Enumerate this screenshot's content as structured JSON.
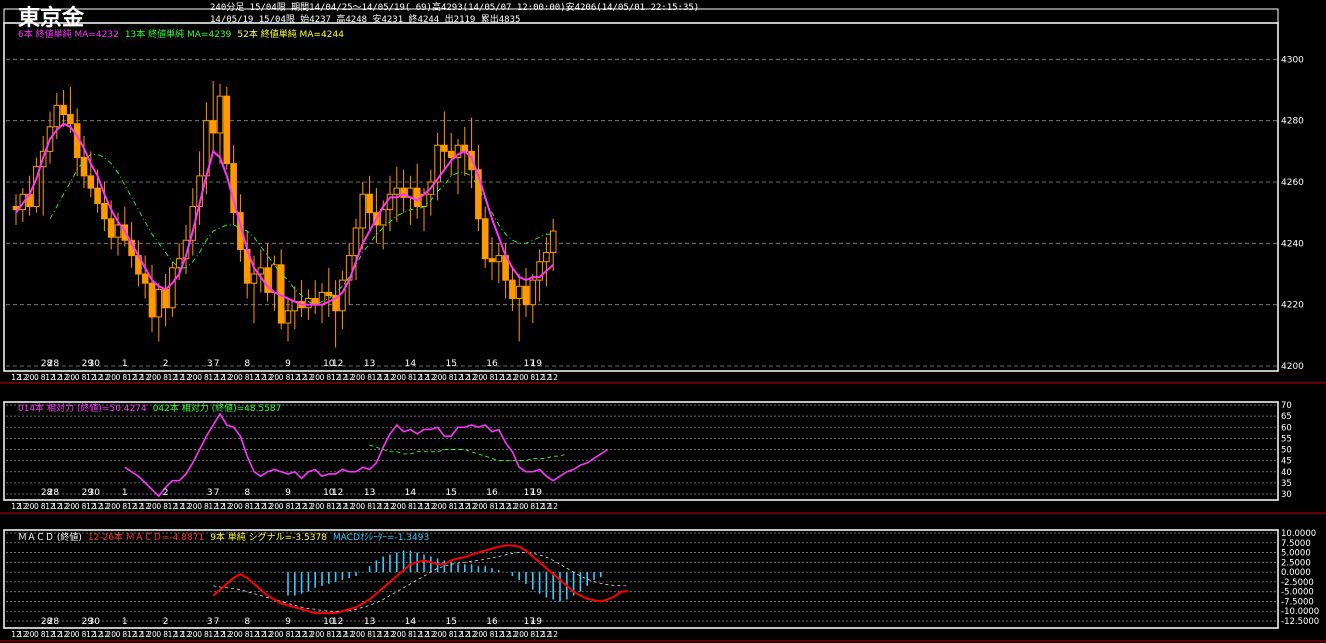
{
  "header": {
    "symbol": "東京金",
    "line1": "240分足 15/04限 期間14/04/25～14/05/19( 69)高4293(14/05/07 12:00:00)安4206(14/05/01 22:15:35)",
    "line2": "14/05/19 15/04限 始4237 高4248 安4231 終4244 出2119 累出4835"
  },
  "main_legend": [
    {
      "text": "6本 終値単純 MA=4232",
      "color": "#ff33ff"
    },
    {
      "text": "13本 終値単純 MA=4239",
      "color": "#33ff33"
    },
    {
      "text": "52本 終値単純 MA=4244",
      "color": "#ffff33"
    }
  ],
  "rsi_legend": [
    {
      "text": "014本 相対力 (終値)=50.4274",
      "color": "#ff33ff"
    },
    {
      "text": "042本 相対力 (終値)=48.5587",
      "color": "#33ff33"
    }
  ],
  "macd_legend": [
    {
      "text": "ＭＡＣＤ (終値)",
      "color": "#ffffff"
    },
    {
      "text": "12-26本 ＭＡＣＤ=-4.8871",
      "color": "#ff3333"
    },
    {
      "text": "9本 単純 シグナル=-3.5378",
      "color": "#ffff33"
    },
    {
      "text": "MACDｵｼﾚｰﾀｰ=-1.3493",
      "color": "#33ccff"
    }
  ],
  "colors": {
    "candle": "#ff9900",
    "ma6": "#ff33ff",
    "ma13": "#33ff33",
    "grid": "#888888",
    "border": "#ffffff",
    "separator": "#cc0000",
    "macd": "#ff0000",
    "signal": "#ffffff",
    "osc": "#33ccff"
  },
  "chart_data": [
    {
      "type": "candlestick",
      "id": "price",
      "ylim": [
        4200,
        4305
      ],
      "y_ticks": [
        "4200",
        "4220",
        "4240",
        "4260",
        "4280",
        "4300"
      ],
      "date_labels": [
        {
          "i": 4.5,
          "t": "28"
        },
        {
          "i": 5.5,
          "t": "28"
        },
        {
          "i": 10.5,
          "t": "29"
        },
        {
          "i": 11.5,
          "t": "30"
        },
        {
          "i": 16,
          "t": "1"
        },
        {
          "i": 22,
          "t": "2"
        },
        {
          "i": 28.5,
          "t": "3"
        },
        {
          "i": 29.5,
          "t": "7"
        },
        {
          "i": 34,
          "t": "8"
        },
        {
          "i": 40,
          "t": "9"
        },
        {
          "i": 46,
          "t": "10"
        },
        {
          "i": 47.3,
          "t": "12"
        },
        {
          "i": 52,
          "t": "13"
        },
        {
          "i": 58,
          "t": "14"
        },
        {
          "i": 64,
          "t": "15"
        },
        {
          "i": 70,
          "t": "16"
        },
        {
          "i": 75.5,
          "t": "17"
        },
        {
          "i": 76.5,
          "t": "19"
        }
      ],
      "time_cycle": [
        "12",
        "12",
        "20",
        "0",
        "8",
        "12"
      ],
      "ohlc": [
        [
          4252,
          4256,
          4246,
          4251
        ],
        [
          4251,
          4258,
          4247,
          4256
        ],
        [
          4256,
          4262,
          4249,
          4252
        ],
        [
          4252,
          4268,
          4250,
          4265
        ],
        [
          4265,
          4275,
          4249,
          4270
        ],
        [
          4270,
          4283,
          4266,
          4278
        ],
        [
          4278,
          4289,
          4274,
          4285
        ],
        [
          4285,
          4290,
          4278,
          4282
        ],
        [
          4282,
          4291,
          4276,
          4279
        ],
        [
          4279,
          4284,
          4262,
          4268
        ],
        [
          4268,
          4275,
          4258,
          4262
        ],
        [
          4262,
          4270,
          4255,
          4258
        ],
        [
          4258,
          4264,
          4250,
          4253
        ],
        [
          4253,
          4260,
          4244,
          4248
        ],
        [
          4248,
          4254,
          4238,
          4242
        ],
        [
          4242,
          4250,
          4236,
          4246
        ],
        [
          4246,
          4252,
          4239,
          4241
        ],
        [
          4241,
          4247,
          4232,
          4236
        ],
        [
          4236,
          4241,
          4226,
          4230
        ],
        [
          4230,
          4236,
          4222,
          4227
        ],
        [
          4227,
          4233,
          4211,
          4216
        ],
        [
          4216,
          4227,
          4208,
          4225
        ],
        [
          4225,
          4230,
          4213,
          4219
        ],
        [
          4219,
          4234,
          4216,
          4232
        ],
        [
          4232,
          4240,
          4228,
          4235
        ],
        [
          4235,
          4246,
          4230,
          4241
        ],
        [
          4241,
          4258,
          4236,
          4252
        ],
        [
          4252,
          4270,
          4246,
          4262
        ],
        [
          4262,
          4286,
          4256,
          4280
        ],
        [
          4280,
          4293,
          4270,
          4276
        ],
        [
          4276,
          4292,
          4266,
          4288
        ],
        [
          4288,
          4291,
          4264,
          4266
        ],
        [
          4266,
          4272,
          4246,
          4250
        ],
        [
          4250,
          4256,
          4234,
          4238
        ],
        [
          4238,
          4244,
          4222,
          4227
        ],
        [
          4227,
          4236,
          4214,
          4230
        ],
        [
          4230,
          4238,
          4224,
          4232
        ],
        [
          4232,
          4240,
          4221,
          4224
        ],
        [
          4224,
          4236,
          4218,
          4233
        ],
        [
          4233,
          4238,
          4212,
          4214
        ],
        [
          4214,
          4222,
          4208,
          4218
        ],
        [
          4218,
          4226,
          4212,
          4221
        ],
        [
          4221,
          4228,
          4216,
          4219
        ],
        [
          4219,
          4225,
          4215,
          4222
        ],
        [
          4222,
          4228,
          4217,
          4220
        ],
        [
          4220,
          4227,
          4214,
          4224
        ],
        [
          4224,
          4232,
          4216,
          4223
        ],
        [
          4223,
          4228,
          4206,
          4218
        ],
        [
          4218,
          4231,
          4212,
          4228
        ],
        [
          4228,
          4240,
          4220,
          4236
        ],
        [
          4236,
          4248,
          4228,
          4245
        ],
        [
          4245,
          4260,
          4238,
          4256
        ],
        [
          4256,
          4262,
          4244,
          4250
        ],
        [
          4250,
          4258,
          4240,
          4246
        ],
        [
          4246,
          4254,
          4238,
          4251
        ],
        [
          4251,
          4262,
          4244,
          4256
        ],
        [
          4256,
          4265,
          4247,
          4258
        ],
        [
          4258,
          4264,
          4250,
          4255
        ],
        [
          4255,
          4262,
          4246,
          4258
        ],
        [
          4258,
          4266,
          4248,
          4252
        ],
        [
          4252,
          4258,
          4244,
          4256
        ],
        [
          4256,
          4264,
          4249,
          4260
        ],
        [
          4260,
          4276,
          4254,
          4272
        ],
        [
          4272,
          4283,
          4264,
          4270
        ],
        [
          4270,
          4276,
          4262,
          4268
        ],
        [
          4268,
          4274,
          4256,
          4272
        ],
        [
          4272,
          4278,
          4262,
          4270
        ],
        [
          4270,
          4281,
          4258,
          4264
        ],
        [
          4264,
          4272,
          4244,
          4248
        ],
        [
          4248,
          4252,
          4232,
          4235
        ],
        [
          4235,
          4242,
          4228,
          4234
        ],
        [
          4234,
          4240,
          4227,
          4236
        ],
        [
          4236,
          4240,
          4222,
          4228
        ],
        [
          4228,
          4232,
          4218,
          4222
        ],
        [
          4222,
          4230,
          4208,
          4226
        ],
        [
          4226,
          4232,
          4216,
          4220
        ],
        [
          4220,
          4230,
          4214,
          4228
        ],
        [
          4228,
          4238,
          4221,
          4234
        ],
        [
          4234,
          4242,
          4226,
          4237
        ],
        [
          4237,
          4248,
          4231,
          4244
        ]
      ],
      "ma6": [
        4250,
        4253,
        4256,
        4261,
        4268,
        4274,
        4277,
        4279,
        4278,
        4275,
        4271,
        4266,
        4262,
        4256,
        4251,
        4247,
        4244,
        4240,
        4236,
        4232,
        4228,
        4226,
        4225,
        4227,
        4230,
        4236,
        4244,
        4253,
        4262,
        4270,
        4268,
        4262,
        4254,
        4246,
        4238,
        4232,
        4229,
        4226,
        4224,
        4223,
        4222,
        4221,
        4220,
        4220,
        4220,
        4220,
        4221,
        4222,
        4224,
        4228,
        4234,
        4240,
        4244,
        4248,
        4252,
        4255,
        4255,
        4256,
        4255,
        4254,
        4256,
        4258,
        4261,
        4264,
        4267,
        4269,
        4270,
        4268,
        4262,
        4255,
        4248,
        4242,
        4236,
        4232,
        4229,
        4228,
        4229,
        4229,
        4231,
        4233
      ],
      "ma13": [
        4248,
        4252,
        4256,
        4260,
        4264,
        4267,
        4269,
        4269,
        4268,
        4266,
        4263,
        4259,
        4255,
        4251,
        4247,
        4243,
        4240,
        4237,
        4234,
        4232,
        4232,
        4234,
        4237,
        4241,
        4244,
        4245,
        4246,
        4246,
        4245,
        4244,
        4242,
        4239,
        4236,
        4233,
        4230,
        4228,
        4225,
        4223,
        4221,
        4220,
        4221,
        4222,
        4224,
        4226,
        4229,
        4233,
        4237,
        4240,
        4243,
        4245,
        4247,
        4249,
        4250,
        4251,
        4251,
        4252,
        4254,
        4257,
        4259,
        4262,
        4263,
        4263,
        4262,
        4258,
        4254,
        4250,
        4246,
        4243,
        4241,
        4240,
        4240,
        4241,
        4242,
        4243,
        4243
      ],
      "ma13_start": 5
    },
    {
      "type": "line",
      "id": "rsi",
      "ylim": [
        30,
        70
      ],
      "y_ticks": [
        "30",
        "35",
        "40",
        "45",
        "50",
        "55",
        "60",
        "65",
        "70"
      ],
      "rsi14_start": 16,
      "rsi14": [
        42,
        40,
        38,
        35,
        32,
        29,
        33,
        36,
        36,
        39,
        44,
        50,
        56,
        61,
        66,
        61,
        60,
        56,
        47,
        40,
        38,
        40,
        41,
        40,
        39,
        40,
        37,
        40,
        41,
        38,
        39,
        39,
        41,
        40,
        40,
        42,
        41,
        44,
        51,
        57,
        61,
        58,
        59,
        57,
        59,
        59,
        60,
        56,
        56,
        60,
        60,
        61,
        60,
        61,
        58,
        59,
        53,
        49,
        42,
        40,
        40,
        41,
        38,
        36,
        38,
        40,
        41,
        43,
        44,
        46,
        48,
        50
      ],
      "rsi42_start": 52,
      "rsi42": [
        52,
        51,
        50,
        49,
        49,
        48,
        48,
        49,
        49,
        49,
        49,
        50,
        50,
        50,
        50,
        49,
        48,
        47,
        46,
        45,
        45,
        45,
        45,
        45,
        46,
        46,
        46,
        47,
        47,
        48
      ]
    },
    {
      "type": "macd",
      "id": "macd",
      "ylim": [
        -12.5,
        10
      ],
      "y_ticks": [
        "10.0000",
        "7.5000",
        "5.0000",
        "2.5000",
        "0.0000",
        "-2.5000",
        "-5.0000",
        "-7.5000",
        "-10.0000",
        "-12.5000"
      ],
      "start": 29,
      "macd": [
        -6.0,
        -4.5,
        -3.0,
        -1.5,
        -0.5,
        -1.5,
        -3.0,
        -4.5,
        -6.0,
        -7.0,
        -8.0,
        -8.5,
        -9.0,
        -9.5,
        -10.0,
        -10.5,
        -10.5,
        -10.5,
        -10.5,
        -10.0,
        -9.5,
        -9.0,
        -8.0,
        -7.0,
        -5.5,
        -4.0,
        -2.5,
        -1.0,
        0.5,
        2.0,
        2.5,
        3.0,
        2.5,
        2.0,
        2.0,
        3.0,
        3.5,
        3.8,
        4.5,
        5.0,
        5.5,
        6.0,
        6.5,
        6.8,
        6.8,
        6.5,
        5.5,
        4.0,
        2.5,
        1.0,
        -0.5,
        -2.0,
        -3.5,
        -5.0,
        -6.0,
        -6.8,
        -7.2,
        -7.5,
        -7.0,
        -6.2,
        -5.0,
        -4.9
      ],
      "signal": [
        -3.5,
        -3.8,
        -4.0,
        -4.2,
        -4.5,
        -5.0,
        -5.5,
        -6.0,
        -6.5,
        -7.0,
        -7.5,
        -8.0,
        -8.5,
        -9.0,
        -9.3,
        -9.5,
        -9.8,
        -10.0,
        -10.0,
        -10.0,
        -9.8,
        -9.5,
        -9.0,
        -8.5,
        -7.8,
        -7.0,
        -6.0,
        -5.0,
        -4.0,
        -3.0,
        -2.0,
        -1.0,
        0.0,
        1.0,
        1.5,
        2.0,
        2.3,
        2.5,
        2.8,
        3.0,
        3.3,
        3.6,
        4.0,
        4.4,
        4.8,
        5.0,
        5.0,
        4.8,
        4.4,
        3.8,
        3.0,
        2.0,
        1.0,
        0.0,
        -1.0,
        -1.8,
        -2.4,
        -2.9,
        -3.2,
        -3.4,
        -3.5,
        -3.5
      ],
      "osc_start": 40,
      "osc": [
        -6,
        -6,
        -5.5,
        -5,
        -4,
        -3.5,
        -3,
        -2.5,
        -2,
        -1.5,
        -1,
        0,
        1.5,
        3,
        4,
        4.5,
        5,
        5.5,
        5.5,
        5,
        4.5,
        4,
        3.5,
        3,
        2.5,
        2,
        2,
        2,
        1.5,
        1.5,
        1,
        0.5,
        0,
        -1,
        -2,
        -3,
        -4.5,
        -5.5,
        -6.5,
        -7,
        -7.5,
        -7,
        -6,
        -5,
        -3.5,
        -2,
        -1.3
      ]
    }
  ]
}
